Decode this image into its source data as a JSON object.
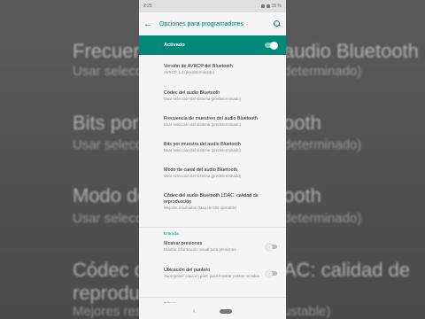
{
  "status": {
    "time": "2:25",
    "battery": "15 %"
  },
  "appbar": {
    "title": "Opciones para programadores"
  },
  "master": {
    "label": "Activado",
    "on": true
  },
  "items": [
    {
      "title": "Versión de AVRCP del Bluetooth",
      "summary": "AVRCP 1.4 (predeterminado)"
    },
    {
      "title": "Códec del audio Bluetooth",
      "summary": "Usar selección del sistema (predeterminado)"
    },
    {
      "title": "Frecuencia de muestreo del audio Bluetooth",
      "summary": "Usar selección del sistema (predeterminado)"
    },
    {
      "title": "Bits por muestra del audio Bluetooth",
      "summary": "Usar selección del sistema (predeterminado)"
    },
    {
      "title": "Modo de canal del audio Bluetooth",
      "summary": "Usar selección del sistema (predeterminado)"
    },
    {
      "title": "Códec del audio Bluetooth LDAC: calidad de reproducción",
      "summary": "Mejores resultados (tasa de bits ajustable)"
    }
  ],
  "input_section": {
    "header": "Entrada",
    "toggles": [
      {
        "title": "Mostrar presiones",
        "summary": "Mostrar información visual para presiones",
        "on": false
      },
      {
        "title": "Ubicación del puntero",
        "summary": "Superponer capa en pant. para mostrar puntos tocados",
        "on": false
      }
    ]
  },
  "drawing_section": {
    "header": "Dibujo"
  },
  "background": {
    "line1": "Frecuencia",
    "line1_right": "audio Bluetooth",
    "line2": "Usar selecc",
    "line2_right": "determinado)",
    "line3": "Bits por m",
    "line3_right": "ooth",
    "line4": "Usar selecc",
    "line4_right": "determinado)",
    "line5": "Modo de",
    "line5_right": "ooth",
    "line6": "Usar selecc",
    "line6_right": "determinado)",
    "line7": "Códec del",
    "line7_right": "AC: calidad de",
    "line8": "reproducció",
    "line9": "Mejores res",
    "line9_right": "ustable)"
  },
  "colors": {
    "accent": "#00897b"
  }
}
